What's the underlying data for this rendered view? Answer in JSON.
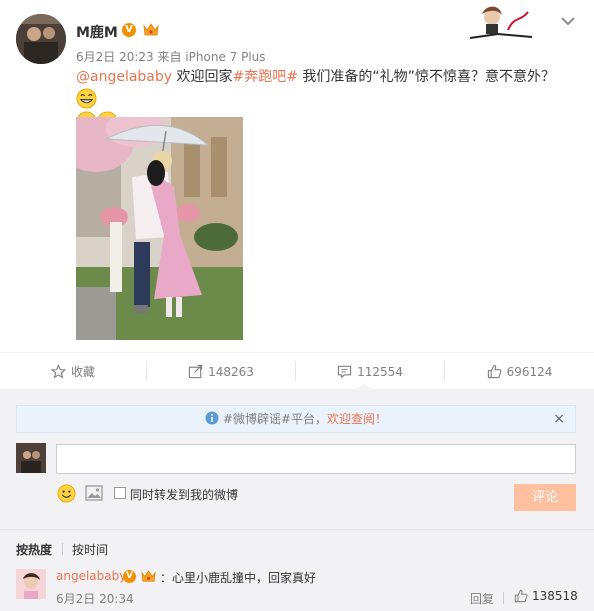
{
  "post": {
    "author": "M鹿M",
    "verified_badge": "V",
    "time": "6月2日 20:23",
    "source_prefix": "来自",
    "source": "iPhone 7 Plus",
    "mention": "@angelababy",
    "text_1": " 欢迎回家",
    "hashtag": "#奔跑吧#",
    "text_2": " 我们准备的“礼物”惊不惊喜？意不意外？",
    "icons": [
      "avatar",
      "vip-crown-icon",
      "chevron-down-icon",
      "grin-emoji",
      "banner-art"
    ]
  },
  "actions": {
    "favorite": "收藏",
    "repost": "148263",
    "comment": "112554",
    "like": "696124"
  },
  "comments": {
    "notice_tag": "#微博辟谣#平台，",
    "notice_link": "欢迎查阅！",
    "notice_close": "×",
    "input_value": "",
    "forward_label": "同时转发到我的微博",
    "submit_label": "评论",
    "sort_hot": "按热度",
    "sort_time": "按时间",
    "items": [
      {
        "user": "angelababy",
        "badge": "V",
        "text": "：心里小鹿乱撞中，回家真好",
        "time": "6月2日 20:34",
        "reply_label": "回复",
        "likes": "138518"
      }
    ]
  },
  "colors": {
    "accent": "#eb7350",
    "meta_gray": "#808080",
    "panel_bg": "#f2f2f5",
    "submit_disabled": "#ffc09f",
    "verified": "#f39000"
  }
}
